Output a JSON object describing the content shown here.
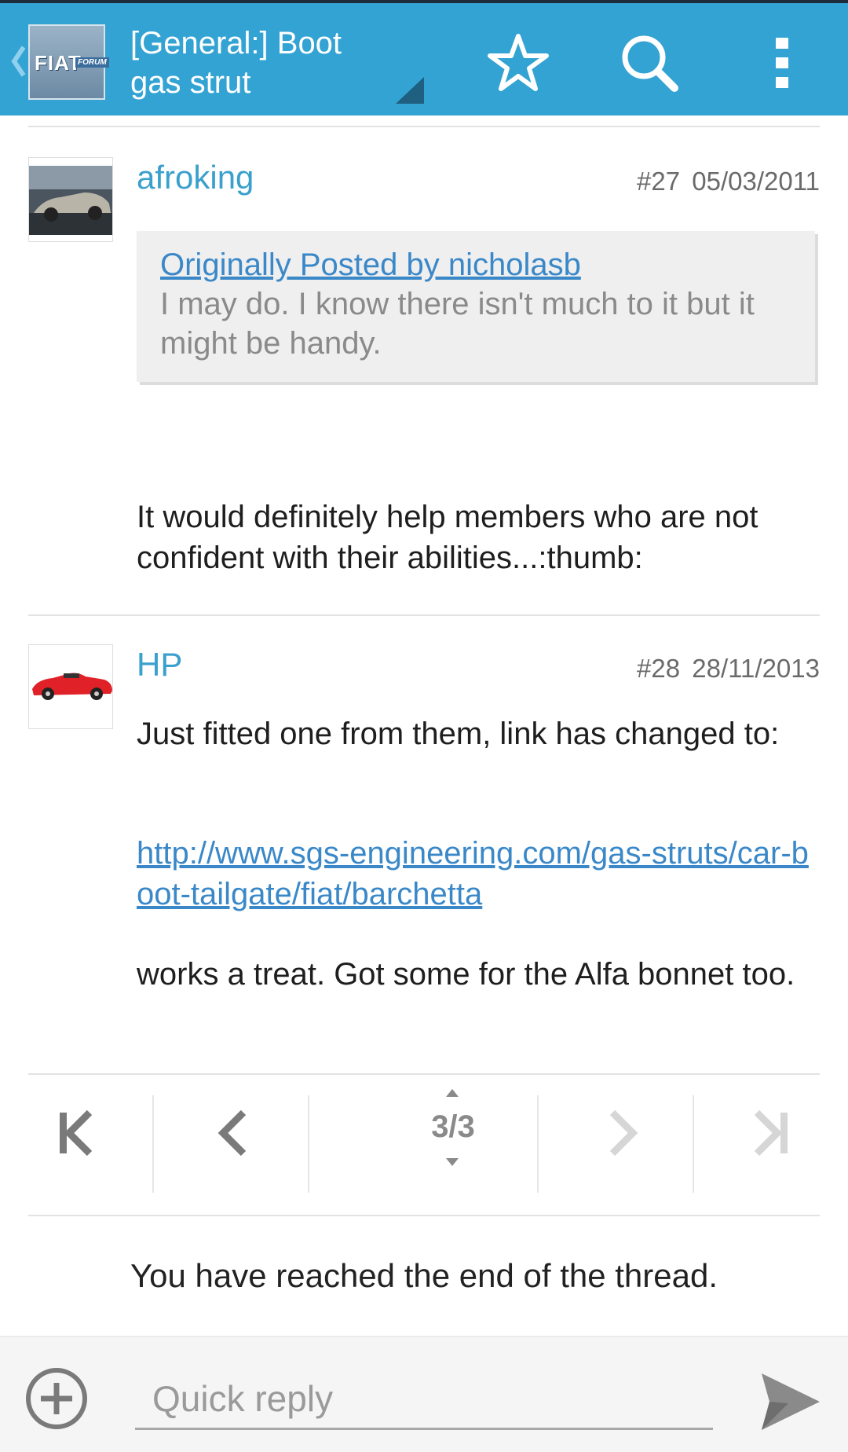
{
  "header": {
    "title": "[General:] Boot gas strut",
    "logo_text": "FIAT",
    "logo_sub": "FORUM",
    "icons": [
      "back-chevron-icon",
      "star-icon",
      "search-icon",
      "overflow-menu-icon"
    ],
    "accent": "#33a3d3"
  },
  "posts": [
    {
      "username": "afroking",
      "number": "#27",
      "date": "05/03/2011",
      "quote": {
        "link": "Originally Posted by nicholasb",
        "text": "I may do. I know there isn't much to it but it might be handy."
      },
      "body": "It would definitely help members who are not confident with their abilities...:thumb:"
    },
    {
      "username": "HP",
      "number": "#28",
      "date": "28/11/2013",
      "body1": "Just fitted one from them, link has changed to:",
      "link": "http://www.sgs-engineering.com/gas-struts/car-boot-tailgate/fiat/barchetta",
      "body2": "works a treat. Got some for the Alfa bonnet too."
    }
  ],
  "pager": {
    "indicator": "3/3",
    "icons": [
      "first-page-icon",
      "previous-page-icon",
      "next-page-icon",
      "last-page-icon"
    ]
  },
  "end_message": "You have reached the end of the thread.",
  "reply": {
    "placeholder": "Quick reply",
    "icons": [
      "add-circle-icon",
      "send-icon"
    ]
  }
}
